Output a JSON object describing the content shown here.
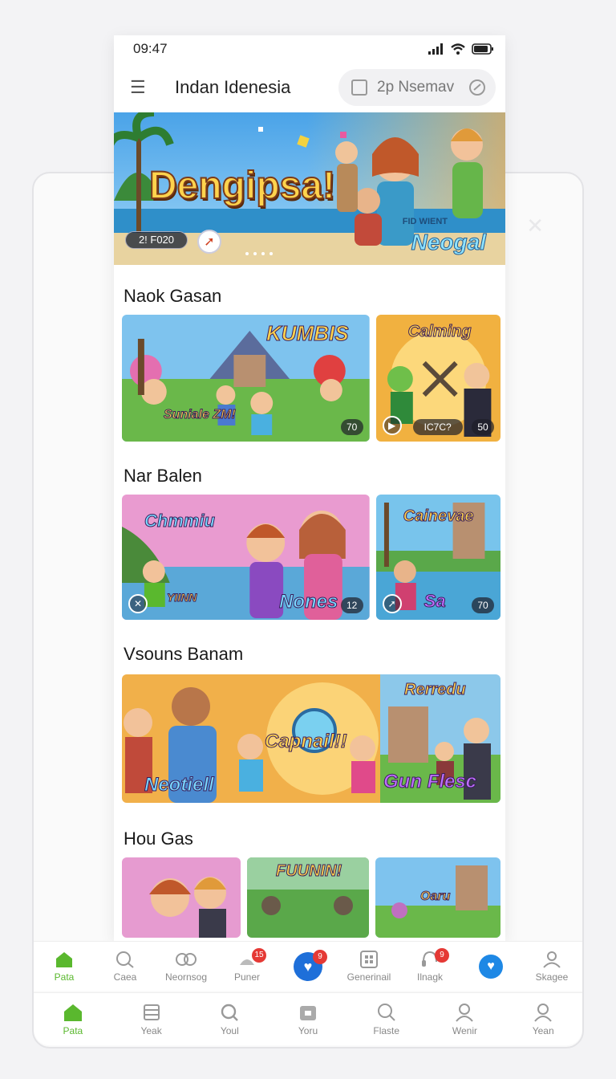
{
  "status": {
    "time": "09:47"
  },
  "appbar": {
    "title": "Indan Idenesia",
    "search_placeholder": "2p Nsemav"
  },
  "hero": {
    "title": "Dengipsa!",
    "subtitle_small": "FID WIENT",
    "subtitle": "Neogal",
    "chip": "2! F020"
  },
  "sections": [
    {
      "title": "Naok Gasan",
      "cards": [
        {
          "title": "KUMBIS",
          "sub": "Suniale ZM!",
          "badge": "70"
        },
        {
          "title": "Calming",
          "sub": "",
          "badge": "50",
          "chip": "IC7C?"
        }
      ]
    },
    {
      "title": "Nar Balen",
      "cards": [
        {
          "title": "Chmmiu",
          "sub": "Nones",
          "badge": "12",
          "extra": "YIINN"
        },
        {
          "title": "Cainevae",
          "sub": "Sa",
          "badge": "70"
        }
      ]
    },
    {
      "title": "Vsouns Banam",
      "cards": [
        {
          "title": "Capnail!!",
          "sub": "Neotiell"
        },
        {
          "title": "Rerredu",
          "sub": "Gun Flesc"
        }
      ]
    },
    {
      "title": "Hou Gas",
      "cards": [
        {
          "title": "",
          "sub": ""
        },
        {
          "title": "FUUNIN!",
          "sub": ""
        },
        {
          "title": "Oaru",
          "sub": ""
        }
      ]
    }
  ],
  "nav_top": [
    {
      "label": "Pata",
      "icon": "home-icon",
      "active": true
    },
    {
      "label": "Caea",
      "icon": "search-icon"
    },
    {
      "label": "Neornsog",
      "icon": "link-icon"
    },
    {
      "label": "Puner",
      "icon": "hat-icon",
      "badge": "15"
    },
    {
      "label": "",
      "icon": "heart-shield-icon",
      "badge": "9"
    },
    {
      "label": "Generinail",
      "icon": "grid-icon"
    },
    {
      "label": "Ilnagk",
      "icon": "headset-icon",
      "badge": "9"
    },
    {
      "label": "",
      "icon": "heart-icon"
    },
    {
      "label": "Skagee",
      "icon": "user-icon"
    }
  ],
  "nav_bottom": [
    {
      "label": "Pata",
      "icon": "home-icon",
      "active": true
    },
    {
      "label": "Yeak",
      "icon": "stack-icon"
    },
    {
      "label": "Youl",
      "icon": "magnifier-icon"
    },
    {
      "label": "Yoru",
      "icon": "box-icon"
    },
    {
      "label": "Flaste",
      "icon": "search-icon"
    },
    {
      "label": "Wenir",
      "icon": "user-icon"
    },
    {
      "label": "Yean",
      "icon": "user-icon"
    }
  ],
  "colors": {
    "accent_green": "#5ab82e",
    "badge_red": "#e53935",
    "blue": "#1e88e5"
  }
}
